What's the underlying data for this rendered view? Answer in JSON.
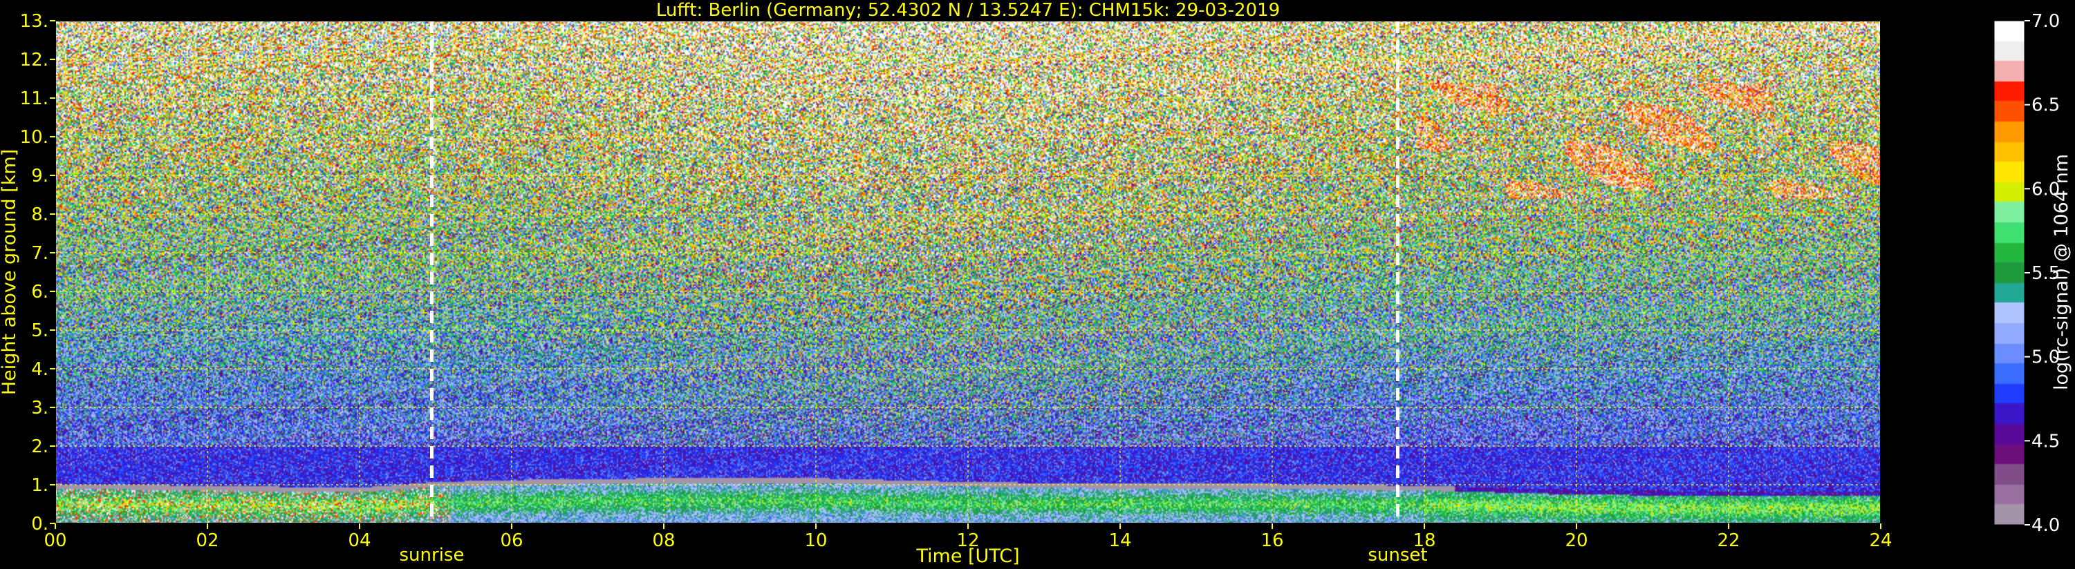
{
  "chart_data": {
    "type": "heatmap",
    "title": "Lufft: Berlin (Germany; 52.4302 N / 13.5247 E):    CHM15k: 29-03-2019",
    "xlabel": "Time [UTC]",
    "ylabel": "Height above ground [km]",
    "xlim": [
      0,
      24
    ],
    "ylim": [
      0,
      13
    ],
    "x_ticks": [
      "00",
      "02",
      "04",
      "06",
      "08",
      "10",
      "12",
      "14",
      "16",
      "18",
      "20",
      "22",
      "24"
    ],
    "y_ticks": [
      "0.",
      "1.",
      "2.",
      "3.",
      "4.",
      "5.",
      "6.",
      "7.",
      "8.",
      "9.",
      "10.",
      "11.",
      "12.",
      "13."
    ],
    "grid": true,
    "annotations": [
      {
        "text": "sunrise",
        "x": 4.95
      },
      {
        "text": "sunset",
        "x": 17.65
      }
    ],
    "vlines_dashed": [
      4.95,
      17.65
    ],
    "colorbar": {
      "label": "log(rc-signal) @ 1064 nm",
      "range": [
        4.0,
        7.0
      ],
      "ticks": [
        "4.0",
        "4.5",
        "5.0",
        "5.5",
        "6.0",
        "6.5",
        "7.0"
      ],
      "colors": [
        "#a494a8",
        "#9a70a0",
        "#7f4e89",
        "#6d0f7b",
        "#5a0898",
        "#3b16c6",
        "#1f3cff",
        "#3a6cff",
        "#6a8cff",
        "#94aaff",
        "#b0c4ff",
        "#23a896",
        "#1c9a3c",
        "#25b640",
        "#40e070",
        "#7ef0a0",
        "#d4f000",
        "#ffe600",
        "#ffc000",
        "#ff9a00",
        "#ff5000",
        "#ff1c00",
        "#f4b0b0",
        "#eeeeee",
        "#ffffff"
      ]
    },
    "boundary_layer": [
      {
        "x": 0,
        "top": 0.9
      },
      {
        "x": 2,
        "top": 0.85
      },
      {
        "x": 4,
        "top": 0.8
      },
      {
        "x": 5,
        "top": 0.95
      },
      {
        "x": 6,
        "top": 1.0
      },
      {
        "x": 8,
        "top": 1.05
      },
      {
        "x": 10,
        "top": 1.05
      },
      {
        "x": 12,
        "top": 0.95
      },
      {
        "x": 14,
        "top": 0.9
      },
      {
        "x": 16,
        "top": 0.9
      },
      {
        "x": 18,
        "top": 0.85
      },
      {
        "x": 20,
        "top": 0.75
      },
      {
        "x": 22,
        "top": 0.7
      },
      {
        "x": 24,
        "top": 0.7
      }
    ],
    "cloud_layers": [
      {
        "x_start": 17.9,
        "x_end": 24,
        "height_low": 8.4,
        "height_high": 11.4
      }
    ]
  }
}
